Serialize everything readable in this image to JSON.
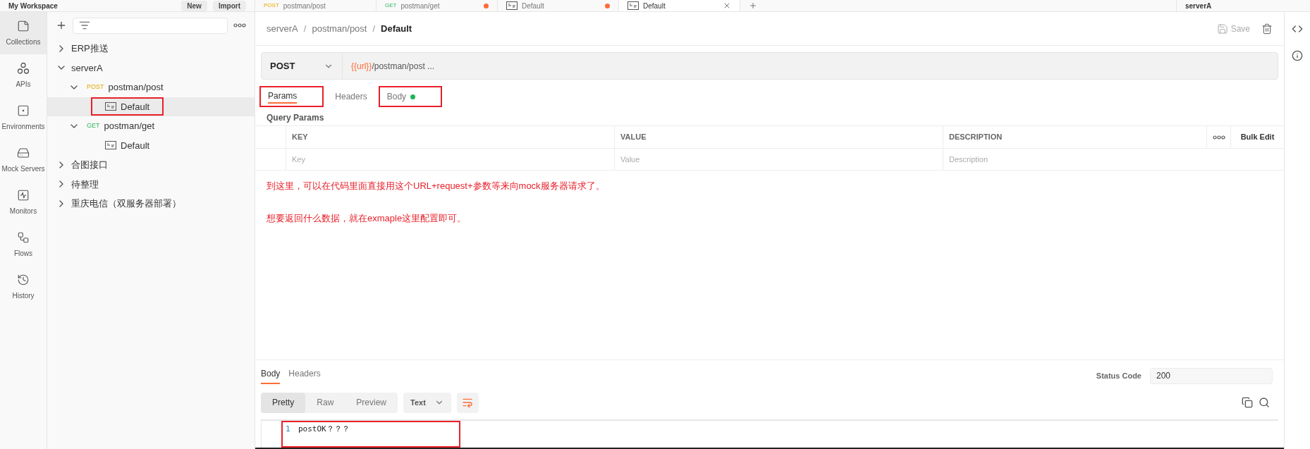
{
  "top_bar": {
    "workspace": "My Workspace",
    "buttons": [
      "New",
      "Import"
    ],
    "tabs": [
      {
        "method": "POST",
        "label": "postman/post",
        "unsaved": false,
        "selected": false
      },
      {
        "method": "GET",
        "label": "postman/get",
        "unsaved": true,
        "selected": false
      },
      {
        "kind": "example",
        "label": "Default",
        "unsaved": true,
        "selected": false
      },
      {
        "kind": "example",
        "label": "Default",
        "unsaved": false,
        "selected": true
      }
    ],
    "environment": "serverA"
  },
  "icon_rail": [
    {
      "kind": "collections",
      "label": "Collections",
      "selected": true
    },
    {
      "kind": "apis",
      "label": "APIs",
      "selected": false
    },
    {
      "kind": "environments",
      "label": "Environments",
      "selected": false
    },
    {
      "kind": "mock",
      "label": "Mock Servers",
      "selected": false
    },
    {
      "kind": "monitors",
      "label": "Monitors",
      "selected": false
    },
    {
      "kind": "flows",
      "label": "Flows",
      "selected": false
    },
    {
      "kind": "history",
      "label": "History",
      "selected": false
    }
  ],
  "sidebar": {
    "tree": [
      {
        "kind": "folder",
        "label": "ERP推送",
        "expanded": false,
        "selected": false
      },
      {
        "kind": "folder",
        "label": "serverA",
        "expanded": true,
        "selected": false,
        "children": [
          {
            "kind": "request",
            "method": "POST",
            "label": "postman/post",
            "expanded": true,
            "selected": false,
            "children": [
              {
                "kind": "example",
                "label": "Default",
                "selected": true,
                "highlighted": true
              }
            ]
          },
          {
            "kind": "request",
            "method": "GET",
            "label": "postman/get",
            "expanded": true,
            "selected": false,
            "children": [
              {
                "kind": "example",
                "label": "Default",
                "selected": false,
                "highlighted": false
              }
            ]
          }
        ]
      },
      {
        "kind": "folder",
        "label": "合图接口",
        "expanded": false,
        "selected": false
      },
      {
        "kind": "folder",
        "label": "待整理",
        "expanded": false,
        "selected": false
      },
      {
        "kind": "folder",
        "label": "重庆电信（双服务器部署）",
        "expanded": false,
        "selected": false
      }
    ]
  },
  "breadcrumb": [
    "serverA",
    "postman/post",
    "Default"
  ],
  "breadcrumb_separator": "/",
  "save_label": "Save",
  "request": {
    "method": "POST",
    "url_variable": "{{url}}",
    "url_path": "/postman/post ..."
  },
  "request_tabs": [
    {
      "label": "Params",
      "selected": true,
      "has_content": false,
      "highlighted": true
    },
    {
      "label": "Headers",
      "selected": false,
      "has_content": false,
      "highlighted": false
    },
    {
      "label": "Body",
      "selected": false,
      "has_content": true,
      "highlighted": true
    }
  ],
  "query_params": {
    "title": "Query Params",
    "columns": [
      "KEY",
      "VALUE",
      "DESCRIPTION"
    ],
    "bulk_edit": "Bulk Edit",
    "placeholders": [
      "Key",
      "Value",
      "Description"
    ]
  },
  "notes": [
    "到这里，可以在代码里面直接用这个URL+request+参数等来向mock服务器请求了。",
    "想要返回什么数据，就在exmaple这里配置即可。"
  ],
  "response": {
    "tabs": [
      {
        "label": "Body",
        "selected": true
      },
      {
        "label": "Headers",
        "selected": false
      }
    ],
    "status_label": "Status Code",
    "status_value": "200",
    "formats": [
      {
        "label": "Pretty",
        "selected": true
      },
      {
        "label": "Raw",
        "selected": false
      },
      {
        "label": "Preview",
        "selected": false
      }
    ],
    "language": "Text",
    "lines": [
      {
        "number": "1",
        "text": "postOK？？？",
        "highlighted": true
      }
    ]
  }
}
